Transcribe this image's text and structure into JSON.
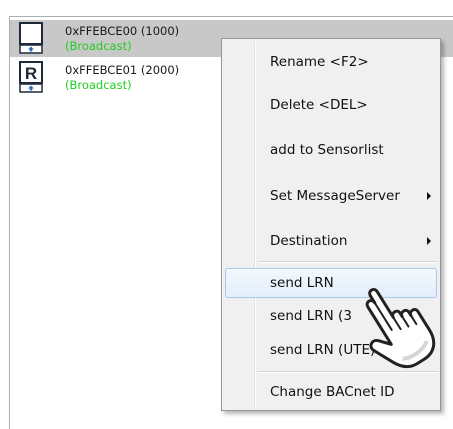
{
  "devices": [
    {
      "id_label": "0xFFEBCE00 (1000)",
      "type_label": "(Broadcast)",
      "icon": "blank-device-icon",
      "selected": true
    },
    {
      "id_label": "0xFFEBCE01 (2000)",
      "type_label": "(Broadcast)",
      "icon": "repeater-device-icon",
      "icon_letter": "R",
      "selected": false
    }
  ],
  "context_menu": {
    "items": [
      {
        "label": "Rename <F2>",
        "has_submenu": false
      },
      {
        "label": "Delete <DEL>",
        "has_submenu": false
      },
      {
        "label": "add to Sensorlist",
        "has_submenu": false
      },
      {
        "label": "Set MessageServer",
        "has_submenu": true
      },
      {
        "label": "Destination",
        "has_submenu": true
      },
      {
        "label": "send LRN",
        "has_submenu": false,
        "hovered": true
      },
      {
        "label": "send LRN (3",
        "has_submenu": false
      },
      {
        "label": "send LRN (UTE)",
        "has_submenu": false
      },
      {
        "label": "Change BACnet ID",
        "has_submenu": false
      }
    ]
  },
  "cursor": {
    "icon": "hand-pointer-cursor-icon"
  },
  "colors": {
    "selected_row": "#c8c8c8",
    "broadcast_text": "#22cc22",
    "menu_background": "#f0f0f0",
    "menu_hover_border": "#a9c8ea"
  }
}
